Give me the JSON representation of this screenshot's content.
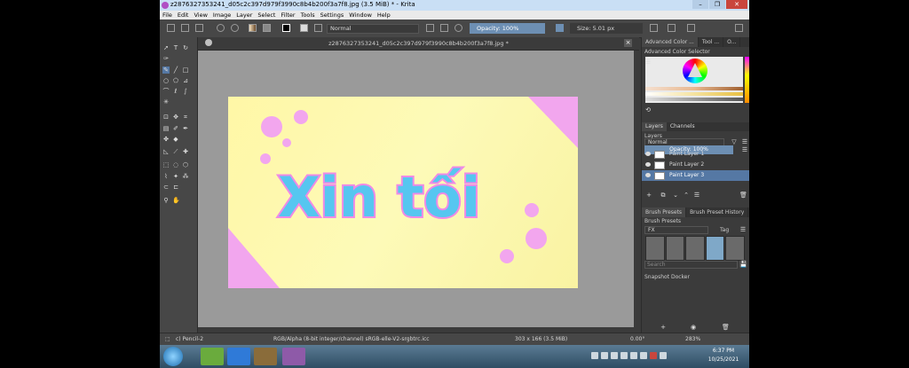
{
  "window": {
    "title": "z2876327353241_d05c2c397d979f3990c8b4b200f3a7f8.jpg (3.5 MiB) * - Krita",
    "min": "–",
    "max": "❐",
    "close": "✕"
  },
  "menu": [
    "File",
    "Edit",
    "View",
    "Image",
    "Layer",
    "Select",
    "Filter",
    "Tools",
    "Settings",
    "Window",
    "Help"
  ],
  "toolbar": {
    "blend_mode": "Normal",
    "opacity": "Opacity: 100%",
    "size": "Size: 5.01 px"
  },
  "document": {
    "tab_name": "z2876327353241_d05c2c397d979f3990c8b4b200f3a7f8.jpg *",
    "close": "×",
    "artwork_text": "Xin tối"
  },
  "dock": {
    "tabs": [
      "Advanced Color ...",
      "Tool ...",
      "O..."
    ],
    "color_selector_title": "Advanced Color Selector",
    "layer_tabs": [
      "Layers",
      "Channels"
    ],
    "layers_title": "Layers",
    "layer_blend": "Normal",
    "layer_opacity": "Opacity:  100%",
    "layers": [
      "Paint Layer 1",
      "Paint Layer 2",
      "Paint Layer 3"
    ],
    "brush_tabs": [
      "Brush Presets",
      "Brush Preset History"
    ],
    "brush_presets_title": "Brush Presets",
    "brush_tag": "FX",
    "tag_btn": "Tag",
    "search_placeholder": "Search",
    "snapshot_title": "Snapshot Docker"
  },
  "status": {
    "brush": "c) Pencil-2",
    "colorspace": "RGB/Alpha (8-bit integer/channel)  sRGB-elle-V2-srgbtrc.icc",
    "dimensions": "303 x 166 (3.5 MiB)",
    "rotation": "0.00°",
    "zoom": "283%"
  },
  "taskbar": {
    "time": "6:37 PM",
    "date": "10/25/2021"
  },
  "colors": {
    "accent": "#6d8fb3",
    "pink": "#f2a6ee",
    "text_blue": "#56c6f0",
    "text_outline": "#ef8ae6",
    "canvas": "#fff7a6"
  }
}
